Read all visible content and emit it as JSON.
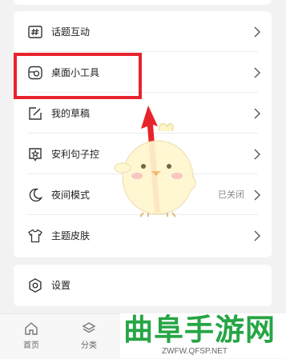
{
  "menu": {
    "items": [
      {
        "label": "话题互动",
        "icon": "hashtag-icon"
      },
      {
        "label": "桌面小工具",
        "icon": "widget-icon"
      },
      {
        "label": "我的草稿",
        "icon": "edit-icon"
      },
      {
        "label": "安利句子控",
        "icon": "star-frame-icon"
      },
      {
        "label": "夜间模式",
        "icon": "moon-icon",
        "value": "已关闭"
      },
      {
        "label": "主题皮肤",
        "icon": "tshirt-icon"
      }
    ]
  },
  "settings": {
    "label": "设置",
    "icon": "gear-icon"
  },
  "bottom_nav": [
    {
      "label": "首页",
      "icon": "home-icon"
    },
    {
      "label": "分类",
      "icon": "layers-icon"
    }
  ],
  "watermark": {
    "title": "曲阜手游网",
    "url": "ZWFW.QFSP.NET"
  },
  "colors": {
    "highlight": "#e8232b",
    "watermark_green": "#26a545"
  }
}
